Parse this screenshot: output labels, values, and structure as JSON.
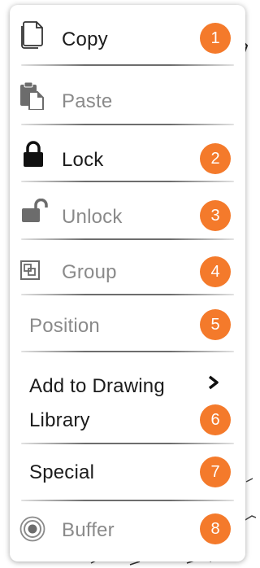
{
  "menu": {
    "items": [
      {
        "label": "Copy",
        "icon": "copy-icon",
        "badge": "1",
        "enabled": true
      },
      {
        "label": "Paste",
        "icon": "paste-icon",
        "enabled": false
      },
      {
        "label": "Lock",
        "icon": "lock-icon",
        "badge": "2",
        "enabled": true
      },
      {
        "label": "Unlock",
        "icon": "unlock-icon",
        "badge": "3",
        "enabled": false
      },
      {
        "label": "Group",
        "icon": "group-icon",
        "badge": "4",
        "enabled": false
      },
      {
        "label": "Position",
        "badge": "5",
        "enabled": false
      },
      {
        "label_line1": "Add to Drawing",
        "label_line2": "Library",
        "icon": "chevron-right-icon",
        "badge": "6",
        "enabled": true
      },
      {
        "label": "Special",
        "badge": "7",
        "enabled": true
      },
      {
        "label": "Buffer",
        "icon": "buffer-icon",
        "badge": "8",
        "enabled": false
      }
    ]
  },
  "colors": {
    "badge": "#f47a2b",
    "enabled_text": "#1c1c1c",
    "disabled_text": "#8a8a8a"
  }
}
